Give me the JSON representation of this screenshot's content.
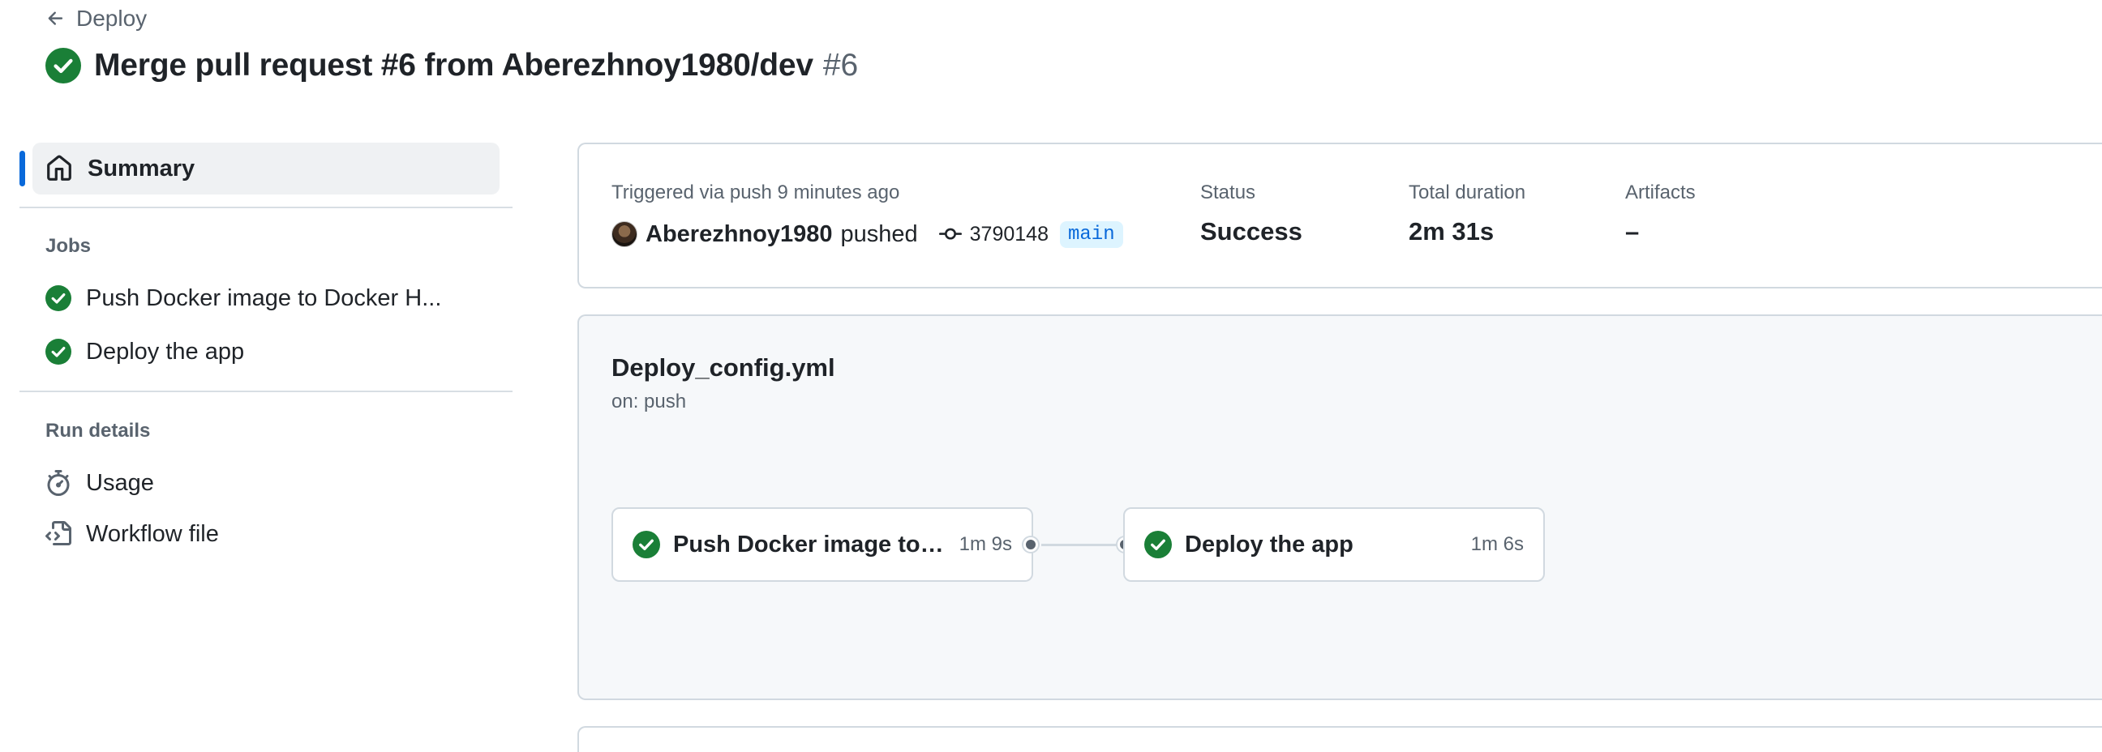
{
  "header": {
    "back_label": "Deploy",
    "title": "Merge pull request #6 from Aberezhnoy1980/dev",
    "run_number": "#6"
  },
  "sidebar": {
    "summary_label": "Summary",
    "jobs_heading": "Jobs",
    "jobs": [
      {
        "label": "Push Docker image to Docker H...",
        "status": "success"
      },
      {
        "label": "Deploy the app",
        "status": "success"
      }
    ],
    "run_details_heading": "Run details",
    "run_details": [
      {
        "label": "Usage",
        "icon": "stopwatch-icon"
      },
      {
        "label": "Workflow file",
        "icon": "file-code-icon"
      }
    ]
  },
  "run_summary": {
    "trigger_text": "Triggered via push 9 minutes ago",
    "actor": "Aberezhnoy1980",
    "action": "pushed",
    "commit_sha": "3790148",
    "branch": "main",
    "status_label": "Status",
    "status_value": "Success",
    "duration_label": "Total duration",
    "duration_value": "2m 31s",
    "artifacts_label": "Artifacts",
    "artifacts_value": "–"
  },
  "workflow": {
    "file_name": "Deploy_config.yml",
    "trigger": "on: push",
    "jobs": [
      {
        "name": "Push Docker image to D...",
        "duration": "1m 9s",
        "status": "success"
      },
      {
        "name": "Deploy the app",
        "duration": "1m 6s",
        "status": "success"
      }
    ]
  },
  "colors": {
    "success": "#1a7f37",
    "accent": "#0969da",
    "muted_text": "#59636e",
    "border": "#d1d9e0"
  }
}
